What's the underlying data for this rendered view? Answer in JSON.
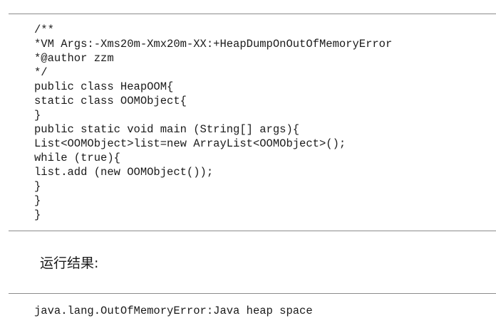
{
  "code": {
    "lines": [
      "/**",
      "*VM Args:-Xms20m-Xmx20m-XX:+HeapDumpOnOutOfMemoryError",
      "*@author zzm",
      "*/",
      "public class HeapOOM{",
      "static class OOMObject{",
      "}",
      "public static void main (String[] args){",
      "List<OOMObject>list=new ArrayList<OOMObject>();",
      "while (true){",
      "list.add (new OOMObject());",
      "}",
      "}",
      "}"
    ]
  },
  "result": {
    "label": "运行结果:",
    "output": "java.lang.OutOfMemoryError:Java heap space"
  }
}
